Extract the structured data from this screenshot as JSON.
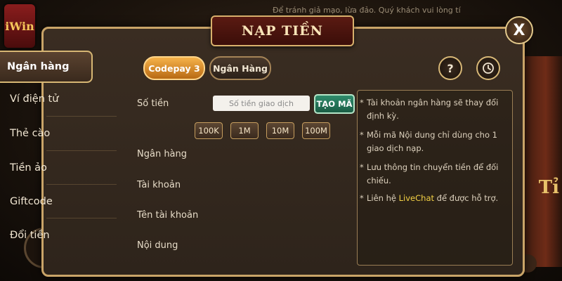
{
  "background": {
    "logo_text": "iWin",
    "marquee_text": "Để tránh giả mạo, lừa đảo. Quý khách vui lòng tí",
    "right_text": "Tỉ"
  },
  "modal": {
    "title": "NẠP TIỀN",
    "close_label": "X"
  },
  "sidebar": {
    "items": [
      {
        "label": "Ngân hàng",
        "active": true
      },
      {
        "label": "Ví điện tử",
        "active": false
      },
      {
        "label": "Thẻ cào",
        "active": false
      },
      {
        "label": "Tiền ảo",
        "active": false
      },
      {
        "label": "Giftcode",
        "active": false
      },
      {
        "label": "Đổi tiền",
        "active": false
      }
    ]
  },
  "tabs": [
    {
      "label": "Codepay 3",
      "active": true
    },
    {
      "label": "Ngân Hàng",
      "active": false
    }
  ],
  "toolbar": {
    "help_label": "?",
    "history_icon": "clock-icon"
  },
  "form": {
    "amount_label": "Số tiền",
    "amount_placeholder": "Số tiền giao dịch",
    "create_button": "TẠO MÃ",
    "quick_amounts": [
      "100K",
      "1M",
      "10M",
      "100M"
    ],
    "bank_label": "Ngân hàng",
    "account_label": "Tài khoản",
    "account_name_label": "Tên tài khoản",
    "content_label": "Nội dung"
  },
  "notes": {
    "bullet": "*",
    "items": [
      "Tài khoản ngân hàng sẽ thay đổi định kỳ.",
      "Mỗi mã Nội dung chỉ dùng cho 1 giao dịch nạp.",
      "Lưu thông tin chuyển tiền để đối chiếu."
    ],
    "last_prefix": "Liên hệ ",
    "last_link": "LiveChat",
    "last_suffix": " để được hỗ trợ."
  },
  "colors": {
    "accent_gold": "#c9a468",
    "active_tab": "#f5b24a",
    "create_button": "#2f8c6c",
    "livechat": "#f4d145"
  }
}
